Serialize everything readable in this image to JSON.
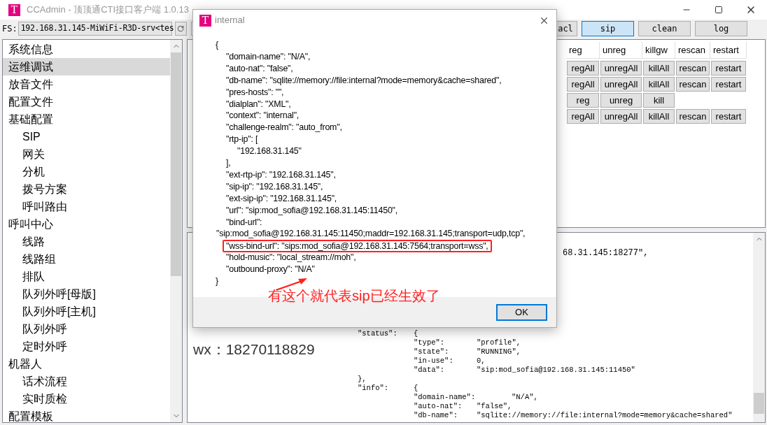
{
  "window": {
    "logo": "T",
    "title": "CCAdmin - 顶顶通CTI接口客户端 1.0.13"
  },
  "toolbar": {
    "fs_label": "FS:",
    "server": "192.168.31.145-MiWiFi-R3D-srv<tes",
    "buttons": [
      {
        "label": "acl",
        "selected": false
      },
      {
        "label": "sip",
        "selected": true
      },
      {
        "label": "clean",
        "selected": false
      },
      {
        "label": "log",
        "selected": false
      }
    ]
  },
  "sidebar": {
    "items": [
      {
        "label": "系统信息",
        "selected": false
      },
      {
        "label": "运维调试",
        "selected": true
      },
      {
        "label": "放音文件",
        "selected": false
      },
      {
        "label": "配置文件",
        "selected": false
      },
      {
        "label": "基础配置",
        "selected": false,
        "children": [
          {
            "label": "SIP",
            "selected": false
          },
          {
            "label": "网关",
            "selected": false
          },
          {
            "label": "分机",
            "selected": false
          },
          {
            "label": "拨号方案",
            "selected": false
          },
          {
            "label": "呼叫路由",
            "selected": false
          }
        ]
      },
      {
        "label": "呼叫中心",
        "selected": false,
        "children": [
          {
            "label": "线路",
            "selected": false
          },
          {
            "label": "线路组",
            "selected": false
          },
          {
            "label": "排队",
            "selected": false
          },
          {
            "label": "队列外呼[母版]",
            "selected": false
          },
          {
            "label": "队列外呼[主机]",
            "selected": false
          },
          {
            "label": "队列外呼",
            "selected": false
          },
          {
            "label": "定时外呼",
            "selected": false
          }
        ]
      },
      {
        "label": "机器人",
        "selected": false,
        "children": [
          {
            "label": "话术流程",
            "selected": false
          },
          {
            "label": "实时质检",
            "selected": false
          }
        ]
      },
      {
        "label": "配置模板",
        "selected": false
      }
    ]
  },
  "profile_table": {
    "columns": [
      "reg",
      "unreg",
      "killgw",
      "rescan",
      "restart"
    ],
    "rows": [
      [
        "regAll",
        "unregAll",
        "killAll",
        "rescan",
        "restart"
      ],
      [
        "regAll",
        "unregAll",
        "killAll",
        "rescan",
        "restart"
      ],
      [
        "reg",
        "unreg",
        "kill"
      ],
      [
        "regAll",
        "unregAll",
        "killAll",
        "rescan",
        "restart"
      ]
    ]
  },
  "output": {
    "fragment": "68.31.145:18277\",",
    "contact": "wx：18270118829",
    "lines": [
      {
        "kind": "outer",
        "key": "\"status\":",
        "value": "{"
      },
      {
        "kind": "inner",
        "key": "\"type\":",
        "value": "\"profile\","
      },
      {
        "kind": "inner",
        "key": "\"state\":",
        "value": "\"RUNNING\","
      },
      {
        "kind": "inner",
        "key": "\"in-use\":",
        "value": "0,"
      },
      {
        "kind": "inner",
        "key": "\"data\":",
        "value": "\"sip:mod_sofia@192.168.31.145:11450\""
      },
      {
        "kind": "close",
        "key": "},"
      },
      {
        "kind": "outer",
        "key": "\"info\":",
        "value": "{"
      },
      {
        "kind": "wide",
        "key": "\"domain-name\":",
        "value": "\"N/A\","
      },
      {
        "kind": "inner",
        "key": "\"auto-nat\":",
        "value": "\"false\","
      },
      {
        "kind": "inner",
        "key": "\"db-name\":",
        "value": "\"sqlite://memory://file:internal?mode=memory&cache=shared\""
      }
    ]
  },
  "dialog": {
    "logo": "T",
    "title": "internal",
    "lines": [
      {
        "kind": "brace",
        "text": "{",
        "highlighted": false
      },
      {
        "kind": "entry",
        "text": "\"domain-name\": \"N/A\",",
        "highlighted": false
      },
      {
        "kind": "entry",
        "text": "\"auto-nat\": \"false\",",
        "highlighted": false
      },
      {
        "kind": "entry",
        "text": "\"db-name\": \"sqlite://memory://file:internal?mode=memory&cache=shared\",",
        "highlighted": false
      },
      {
        "kind": "entry",
        "text": "\"pres-hosts\": \"\",",
        "highlighted": false
      },
      {
        "kind": "entry",
        "text": "\"dialplan\": \"XML\",",
        "highlighted": false
      },
      {
        "kind": "entry",
        "text": "\"context\": \"internal\",",
        "highlighted": false
      },
      {
        "kind": "entry",
        "text": "\"challenge-realm\": \"auto_from\",",
        "highlighted": false
      },
      {
        "kind": "entry",
        "text": "\"rtp-ip\": [",
        "highlighted": false
      },
      {
        "kind": "nested",
        "text": "\"192.168.31.145\"",
        "highlighted": false
      },
      {
        "kind": "entry",
        "text": "],",
        "highlighted": false
      },
      {
        "kind": "entry",
        "text": "\"ext-rtp-ip\": \"192.168.31.145\",",
        "highlighted": false
      },
      {
        "kind": "entry",
        "text": "\"sip-ip\": \"192.168.31.145\",",
        "highlighted": false
      },
      {
        "kind": "entry",
        "text": "\"ext-sip-ip\": \"192.168.31.145\",",
        "highlighted": false
      },
      {
        "kind": "entry",
        "text": "\"url\": \"sip:mod_sofia@192.168.31.145:11450\",",
        "highlighted": false
      },
      {
        "kind": "entry",
        "text": "\"bind-url\":",
        "highlighted": false
      },
      {
        "kind": "wrap",
        "text": "\"sip:mod_sofia@192.168.31.145:11450;maddr=192.168.31.145;transport=udp,tcp\",",
        "highlighted": false
      },
      {
        "kind": "entry",
        "text": "\"wss-bind-url\": \"sips:mod_sofia@192.168.31.145:7564;transport=wss\",",
        "highlighted": true
      },
      {
        "kind": "entry",
        "text": "\"hold-music\": \"local_stream://moh\",",
        "highlighted": false
      },
      {
        "kind": "entry",
        "text": "\"outbound-proxy\": \"N/A\"",
        "highlighted": false
      },
      {
        "kind": "brace",
        "text": "}",
        "highlighted": false
      }
    ],
    "ok_button": "OK"
  },
  "annotation": {
    "text": "有这个就代表sip已经生效了"
  }
}
